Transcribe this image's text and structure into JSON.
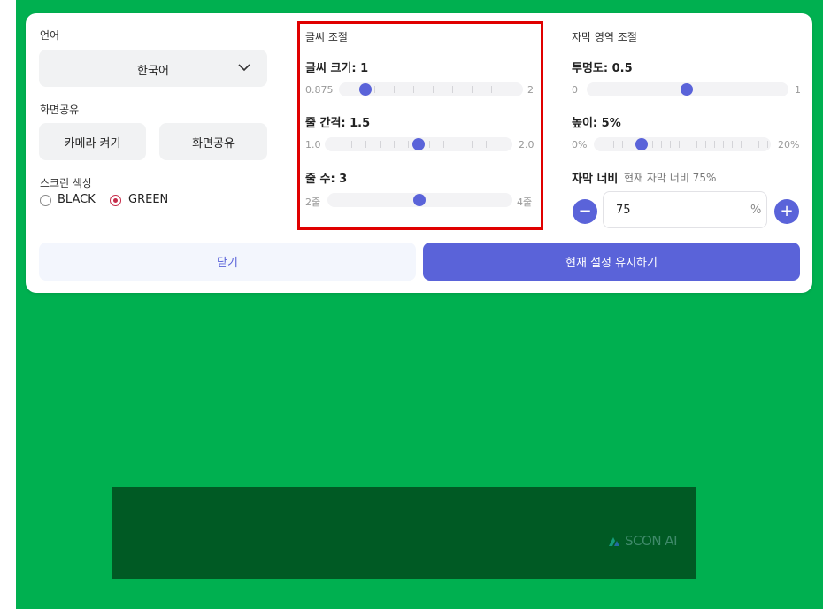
{
  "language": {
    "title": "언어",
    "selected": "한국어"
  },
  "screen_share": {
    "title": "화면공유",
    "camera_label": "카메라 켜기",
    "share_label": "화면공유"
  },
  "screen_color": {
    "title": "스크린 색상",
    "options": [
      {
        "label": "BLACK",
        "selected": false
      },
      {
        "label": "GREEN",
        "selected": true
      }
    ]
  },
  "font": {
    "title": "글씨 조절",
    "size": {
      "label": "글씨 크기: 1",
      "min": "0.875",
      "max": "2",
      "fraction": 0.2
    },
    "spacing": {
      "label": "줄 간격: 1.5",
      "min": "1.0",
      "max": "2.0",
      "fraction": 0.5
    },
    "lines": {
      "label": "줄 수: 3",
      "min": "2줄",
      "max": "4줄",
      "fraction": 0.5
    }
  },
  "subtitle": {
    "title": "자막 영역 조절",
    "opacity": {
      "label": "투명도: 0.5",
      "min": "0",
      "max": "1",
      "fraction": 0.5
    },
    "height": {
      "label": "높이: 5%",
      "min": "0%",
      "max": "20%",
      "fraction": 0.25
    },
    "width": {
      "label": "자막 너비",
      "current": "현재 자막 너비 75%",
      "value": "75",
      "unit": "%"
    }
  },
  "actions": {
    "close_label": "닫기",
    "keep_label": "현재 설정 유지하기"
  },
  "brand": {
    "logo_text": "SCON AI"
  },
  "colors": {
    "accent": "#5a63d9",
    "stage": "#00b050",
    "bar": "#005a24",
    "highlight": "#e00000",
    "radio_on": "#c62c4a"
  }
}
